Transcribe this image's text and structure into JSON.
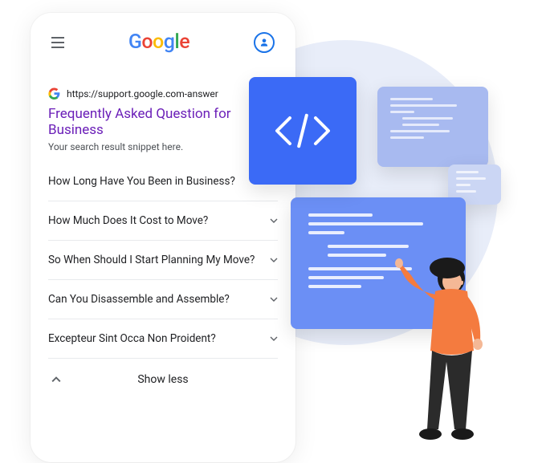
{
  "phone": {
    "result": {
      "url": "https://support.google.com-answer",
      "title": "Frequently Asked Question for Business",
      "snippet": "Your search result snippet here."
    },
    "faqs": [
      "How Long Have You Been in Business?",
      "How Much Does It Cost to Move?",
      "So When Should I Start Planning My Move?",
      "Can You Disassemble and Assemble?",
      "Excepteur Sint Occa Non Proident?"
    ],
    "show_less": "Show less"
  }
}
